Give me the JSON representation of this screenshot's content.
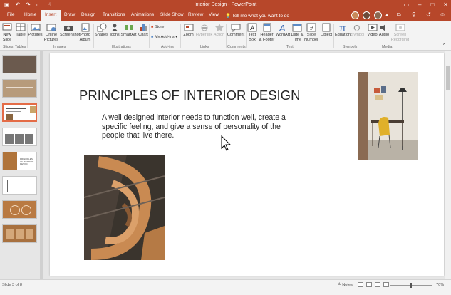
{
  "window": {
    "title": "Interior Design - PowerPoint"
  },
  "tabs": [
    "File",
    "Home",
    "Insert",
    "Draw",
    "Design",
    "Transitions",
    "Animations",
    "Slide Show",
    "Review",
    "View"
  ],
  "tell_me": "Tell me what you want to do",
  "ribbon": {
    "slides": {
      "new_slide": "New Slide",
      "group": "Slides"
    },
    "tables": {
      "table": "Table",
      "group": "Tables"
    },
    "images": {
      "pictures": "Pictures",
      "online_pictures": "Online Pictures",
      "screenshot": "Screenshot",
      "photo_album": "Photo Album",
      "group": "Images"
    },
    "illustrations": {
      "shapes": "Shapes",
      "icons": "Icons",
      "smartart": "SmartArt",
      "chart": "Chart",
      "group": "Illustrations"
    },
    "addins": {
      "store": "Store",
      "my_addins": "My Add-ins",
      "group": "Add-ins"
    },
    "links": {
      "zoom": "Zoom",
      "hyperlink": "Hyperlink",
      "action": "Action",
      "group": "Links"
    },
    "comments": {
      "comment": "Comment",
      "group": "Comments"
    },
    "text": {
      "text_box": "Text Box",
      "header_footer": "Header & Footer",
      "wordart": "WordArt",
      "date_time": "Date & Time",
      "slide_number": "Slide Number",
      "object": "Object",
      "group": "Text"
    },
    "symbols": {
      "equation": "Equation",
      "symbol": "Symbol",
      "group": "Symbols"
    },
    "media": {
      "video": "Video",
      "audio": "Audio",
      "screen_recording": "Screen Recording",
      "group": "Media"
    }
  },
  "slide": {
    "title": "PRINCIPLES OF INTERIOR DESIGN",
    "body": "A well designed interior needs to function well, create a specific feeling, and give a sense of personality of the people that live there."
  },
  "thumbnails": {
    "selected_index": 3,
    "item5_text": "PRINCIPLES OF INTERIOR DESIGN"
  },
  "status": {
    "slide_indicator": "Slide 3 of 8",
    "notes": "Notes",
    "zoom": "70%"
  },
  "colors": {
    "accent": "#b7472a",
    "thumb_highlight": "#e46c47",
    "ribbon_bg": "#f3f3f3"
  }
}
